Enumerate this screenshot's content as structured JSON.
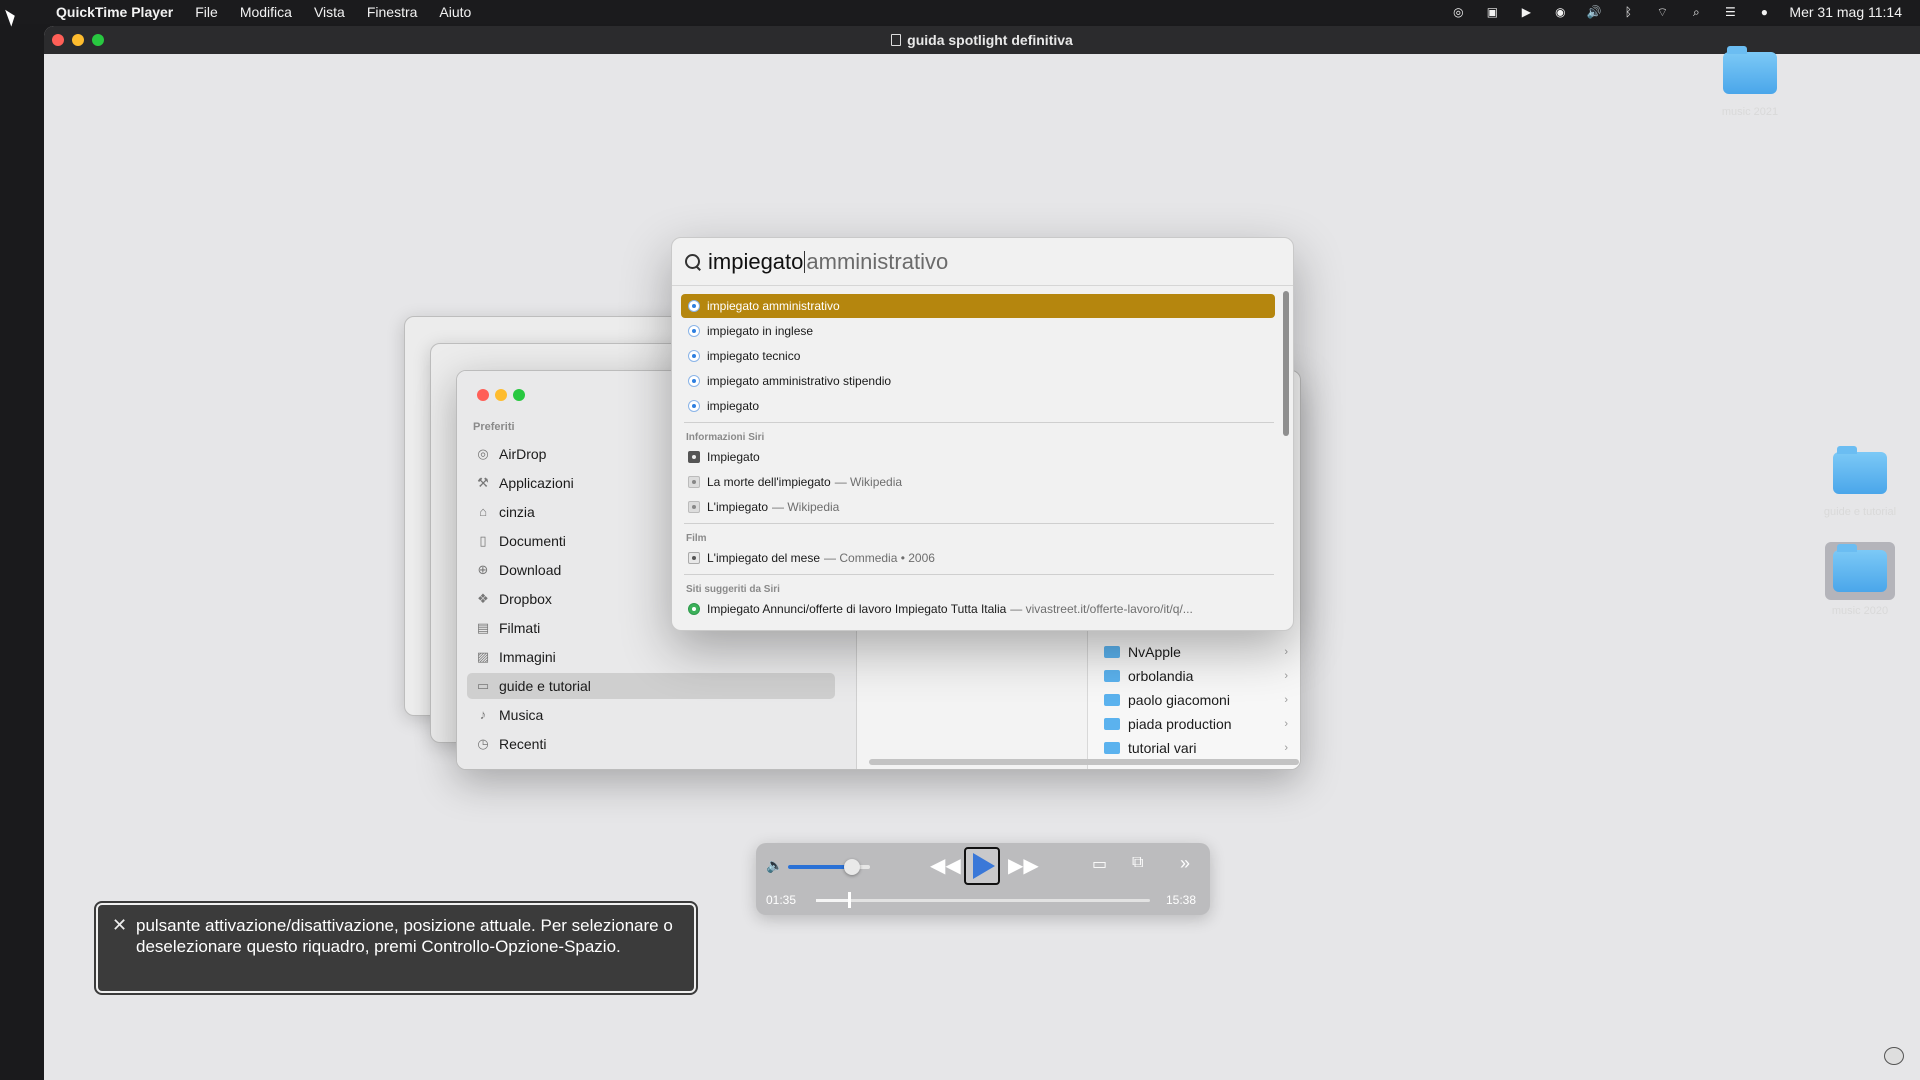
{
  "menubar": {
    "app_name": "QuickTime Player",
    "menus": [
      "File",
      "Modifica",
      "Vista",
      "Finestra",
      "Aiuto"
    ],
    "clock": "Mer 31 mag  11:14"
  },
  "window": {
    "title": "guida spotlight definitiva"
  },
  "desktop": {
    "folders": [
      "music 2021",
      "guide e tutorial",
      "music 2020"
    ]
  },
  "finder": {
    "section": "Preferiti",
    "sidebar_items": [
      {
        "label": "AirDrop",
        "icon": "airdrop-icon"
      },
      {
        "label": "Applicazioni",
        "icon": "applications-icon"
      },
      {
        "label": "cinzia",
        "icon": "home-icon"
      },
      {
        "label": "Documenti",
        "icon": "document-icon"
      },
      {
        "label": "Download",
        "icon": "download-icon"
      },
      {
        "label": "Dropbox",
        "icon": "dropbox-icon"
      },
      {
        "label": "Filmati",
        "icon": "film-icon"
      },
      {
        "label": "Immagini",
        "icon": "image-icon"
      },
      {
        "label": "guide e tutorial",
        "icon": "folder-icon"
      },
      {
        "label": "Musica",
        "icon": "music-icon"
      },
      {
        "label": "Recenti",
        "icon": "clock-icon"
      }
    ],
    "selected_item": "guide e tutorial",
    "column_items": [
      "NvApple",
      "orbolandia",
      "paolo giacomoni",
      "piada production",
      "tutorial vari"
    ]
  },
  "spotlight": {
    "query": "impiegato",
    "completion": " amministrativo",
    "suggestions": [
      "impiegato amministrativo",
      "impiegato in inglese",
      "impiegato tecnico",
      "impiegato amministrativo stipendio",
      "impiegato"
    ],
    "siri_header": "Informazioni Siri",
    "siri_items": [
      {
        "title": "Impiegato",
        "sub": ""
      },
      {
        "title": "La morte dell'impiegato",
        "sub": "— Wikipedia"
      },
      {
        "title": "L'impiegato",
        "sub": "— Wikipedia"
      }
    ],
    "film_header": "Film",
    "film_item": {
      "title": "L'impiegato del mese",
      "sub": "— Commedia • 2006"
    },
    "sites_header": "Siti suggeriti da Siri",
    "site_item": {
      "title": "Impiegato Annunci/offerte di lavoro Impiegato Tutta Italia",
      "sub": "— vivastreet.it/offerte-lavoro/it/q/..."
    }
  },
  "player": {
    "current_time": "01:35",
    "total_time": "15:38",
    "volume_fraction": 0.78,
    "progress_fraction": 0.1
  },
  "voiceover": {
    "caption": "pulsante attivazione/disattivazione, posizione attuale. Per selezionare o deselezionare questo riquadro, premi Controllo-Opzione-Spazio."
  }
}
